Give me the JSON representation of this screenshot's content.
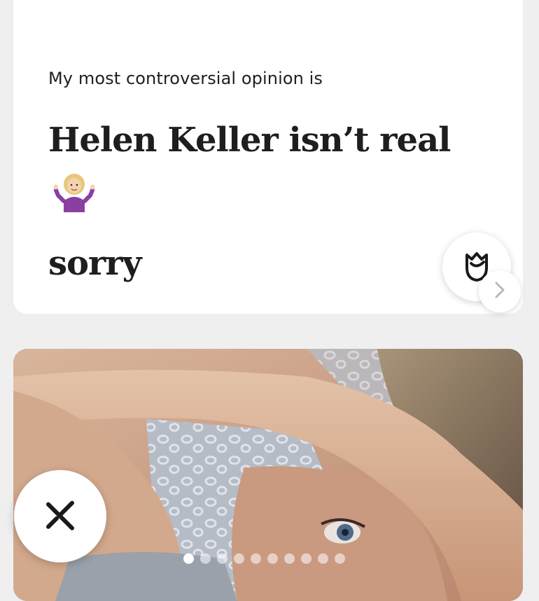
{
  "prompt": {
    "question": "My most controversial opinion is",
    "answer": "Helen Keller isn’t real",
    "answer_line2": "sorry",
    "emoji": "person-shrugging-emoji"
  },
  "actions": {
    "like_icon": "rose-icon",
    "next_icon": "chevron-right-icon",
    "dismiss_icon": "close-x-icon"
  },
  "photo": {
    "description_icon": "profile-photo",
    "carousel_count": 10,
    "carousel_active_index": 0
  },
  "colors": {
    "background": "#efefef",
    "card": "#ffffff",
    "text": "#1e1e1e"
  }
}
